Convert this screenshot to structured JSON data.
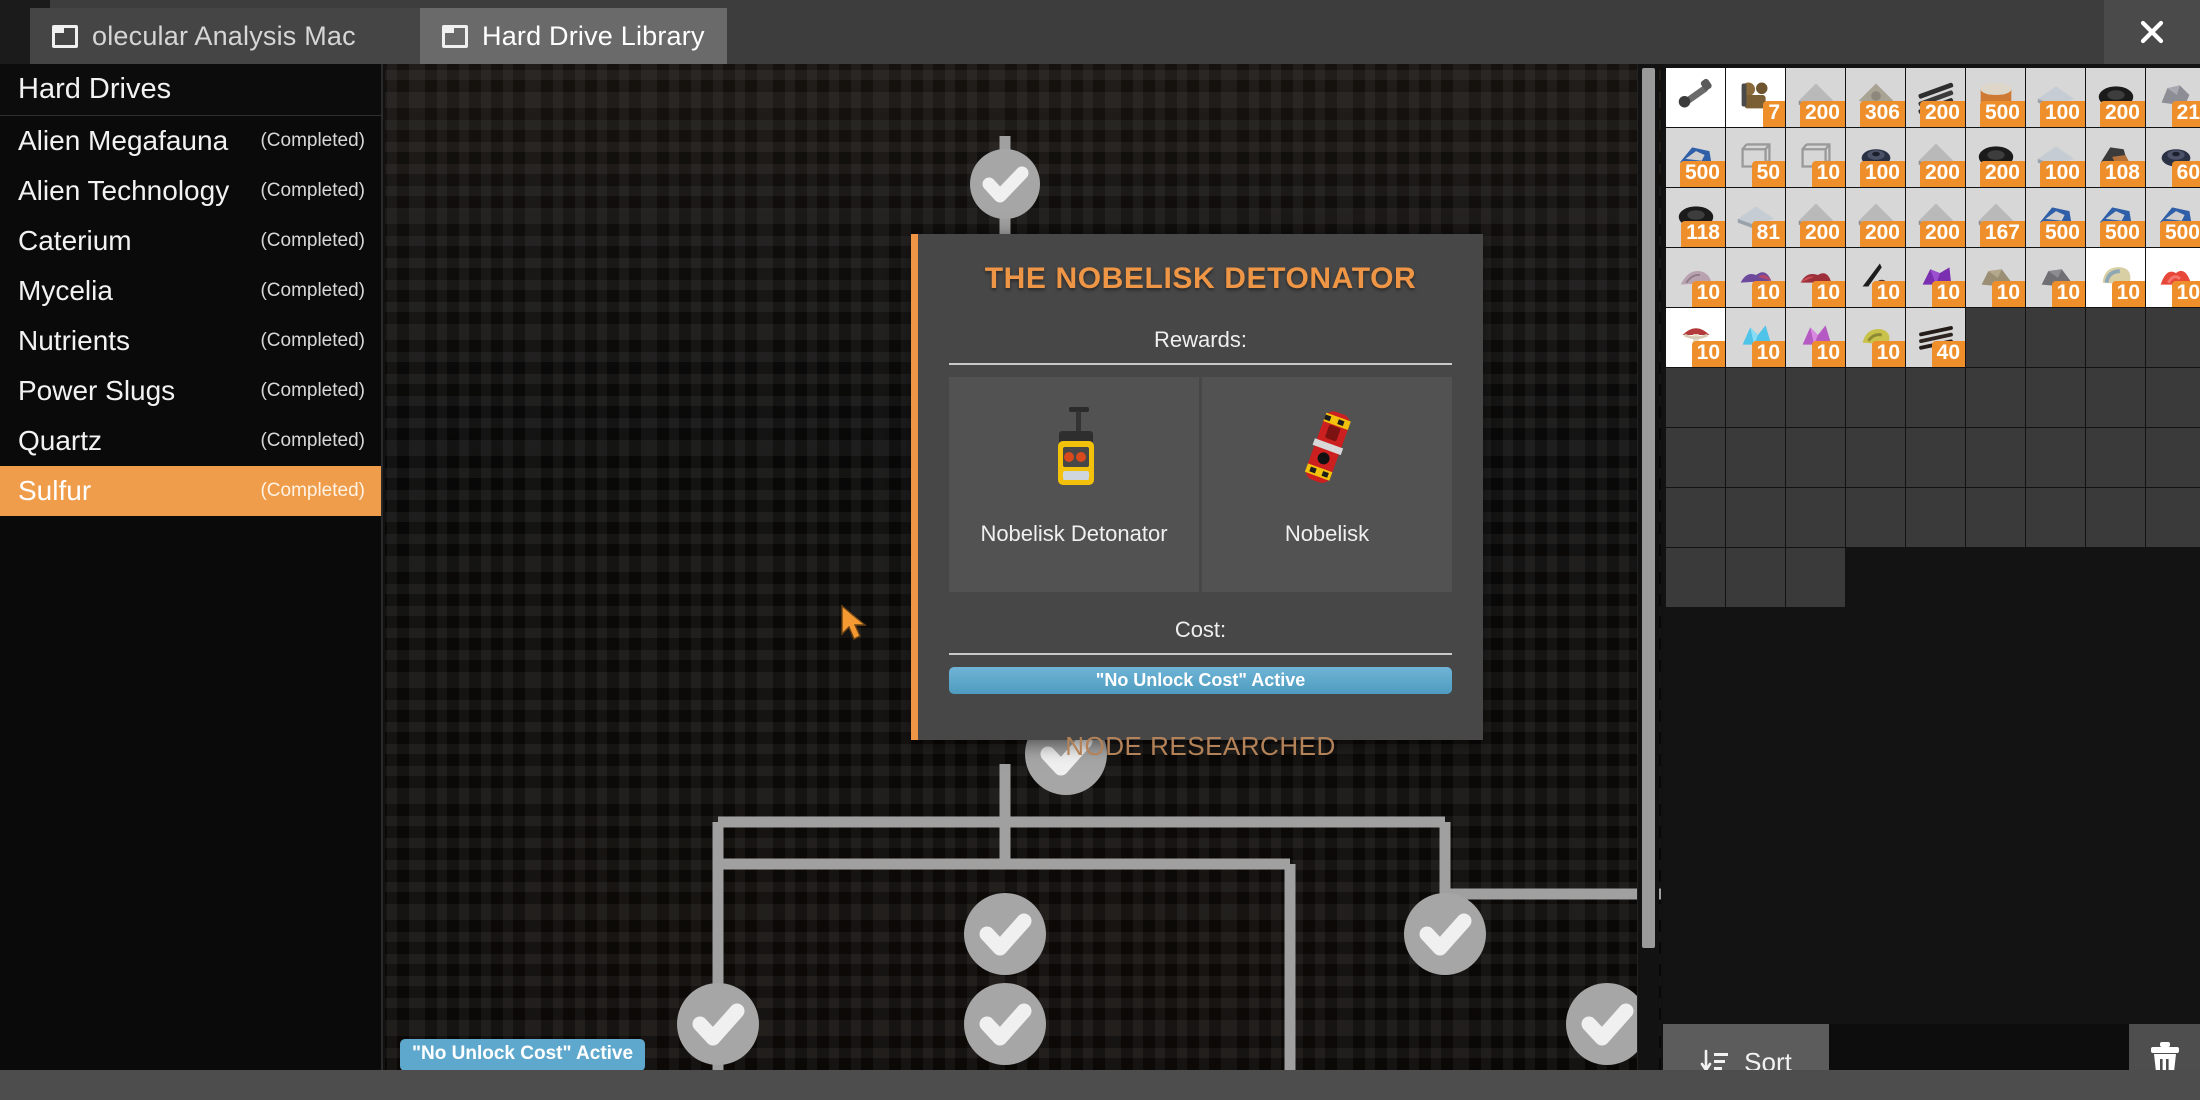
{
  "window": {
    "close_label": "✕",
    "tabs": [
      {
        "label": "olecular Analysis Mac",
        "icon": "window-icon",
        "active": false
      },
      {
        "label": "Hard Drive Library",
        "icon": "window-icon",
        "active": true
      }
    ]
  },
  "sidebar": {
    "header": "Hard Drives",
    "items": [
      {
        "name": "Alien Megafauna",
        "status": "(Completed)",
        "selected": false
      },
      {
        "name": "Alien Technology",
        "status": "(Completed)",
        "selected": false
      },
      {
        "name": "Caterium",
        "status": "(Completed)",
        "selected": false
      },
      {
        "name": "Mycelia",
        "status": "(Completed)",
        "selected": false
      },
      {
        "name": "Nutrients",
        "status": "(Completed)",
        "selected": false
      },
      {
        "name": "Power Slugs",
        "status": "(Completed)",
        "selected": false
      },
      {
        "name": "Quartz",
        "status": "(Completed)",
        "selected": false
      },
      {
        "name": "Sulfur",
        "status": "(Completed)",
        "selected": true
      }
    ]
  },
  "tree": {
    "no_unlock_cost_badge": "\"No Unlock Cost\" Active"
  },
  "popup": {
    "title": "THE NOBELISK DETONATOR",
    "rewards_label": "Rewards:",
    "rewards": [
      {
        "label": "Nobelisk Detonator",
        "icon": "detonator-icon"
      },
      {
        "label": "Nobelisk",
        "icon": "nobelisk-icon"
      }
    ],
    "cost_label": "Cost:",
    "cost_bar_text": "\"No Unlock Cost\" Active",
    "status": "NODE RESEARCHED",
    "accent_color": "#ef9646",
    "cost_bar_color": "#5fa8cd",
    "status_color": "#b48258"
  },
  "inventory": {
    "slots": [
      {
        "count": "",
        "icon": "tool-icon",
        "tone": "light"
      },
      {
        "count": "7",
        "icon": "gear-parts-icon",
        "tone": "light"
      },
      {
        "count": "200",
        "icon": "plate-icon",
        "tone": "normal"
      },
      {
        "count": "306",
        "icon": "reinforced-plate-icon",
        "tone": "normal"
      },
      {
        "count": "200",
        "icon": "rod-icon",
        "tone": "normal"
      },
      {
        "count": "500",
        "icon": "concrete-icon",
        "tone": "normal"
      },
      {
        "count": "100",
        "icon": "sheet-icon",
        "tone": "normal"
      },
      {
        "count": "200",
        "icon": "rubber-icon",
        "tone": "normal"
      },
      {
        "count": "21",
        "icon": "ore-icon",
        "tone": "normal"
      },
      {
        "count": "500",
        "icon": "wire-icon",
        "tone": "normal"
      },
      {
        "count": "50",
        "icon": "frame-icon",
        "tone": "normal"
      },
      {
        "count": "10",
        "icon": "frame-icon",
        "tone": "normal"
      },
      {
        "count": "100",
        "icon": "rotor-icon",
        "tone": "normal"
      },
      {
        "count": "200",
        "icon": "plate-icon",
        "tone": "normal"
      },
      {
        "count": "200",
        "icon": "rubber-icon",
        "tone": "normal"
      },
      {
        "count": "100",
        "icon": "sheet-icon",
        "tone": "normal"
      },
      {
        "count": "108",
        "icon": "copper-icon",
        "tone": "normal"
      },
      {
        "count": "60",
        "icon": "rotor-icon",
        "tone": "normal"
      },
      {
        "count": "118",
        "icon": "rubber-icon",
        "tone": "normal"
      },
      {
        "count": "81",
        "icon": "sheet-icon",
        "tone": "normal"
      },
      {
        "count": "200",
        "icon": "plate-icon",
        "tone": "normal"
      },
      {
        "count": "200",
        "icon": "plate-icon",
        "tone": "normal"
      },
      {
        "count": "200",
        "icon": "plate-icon",
        "tone": "normal"
      },
      {
        "count": "167",
        "icon": "plate-icon",
        "tone": "normal"
      },
      {
        "count": "500",
        "icon": "wire-icon",
        "tone": "normal"
      },
      {
        "count": "500",
        "icon": "wire-icon",
        "tone": "normal"
      },
      {
        "count": "500",
        "icon": "wire-icon",
        "tone": "normal"
      },
      {
        "count": "10",
        "icon": "flower-petal-icon",
        "tone": "normal"
      },
      {
        "count": "10",
        "icon": "purple-flora-icon",
        "tone": "normal"
      },
      {
        "count": "10",
        "icon": "red-flora-icon",
        "tone": "normal"
      },
      {
        "count": "10",
        "icon": "spine-icon",
        "tone": "normal"
      },
      {
        "count": "10",
        "icon": "violet-crystal-icon",
        "tone": "normal"
      },
      {
        "count": "10",
        "icon": "rock-icon",
        "tone": "normal"
      },
      {
        "count": "10",
        "icon": "grey-rock-icon",
        "tone": "normal"
      },
      {
        "count": "10",
        "icon": "shell-icon",
        "tone": "light"
      },
      {
        "count": "10",
        "icon": "coral-icon",
        "tone": "light"
      },
      {
        "count": "10",
        "icon": "mushroom-icon",
        "tone": "light"
      },
      {
        "count": "10",
        "icon": "blue-crystal-icon",
        "tone": "normal"
      },
      {
        "count": "10",
        "icon": "pink-crystal-icon",
        "tone": "normal"
      },
      {
        "count": "10",
        "icon": "yellow-shell-icon",
        "tone": "normal"
      },
      {
        "count": "40",
        "icon": "dark-rods-icon",
        "tone": "normal"
      }
    ],
    "empty_slots_after": 40,
    "sort_label": "Sort",
    "trash_label": "trash-icon",
    "accent_color": "#ef8f2b"
  }
}
